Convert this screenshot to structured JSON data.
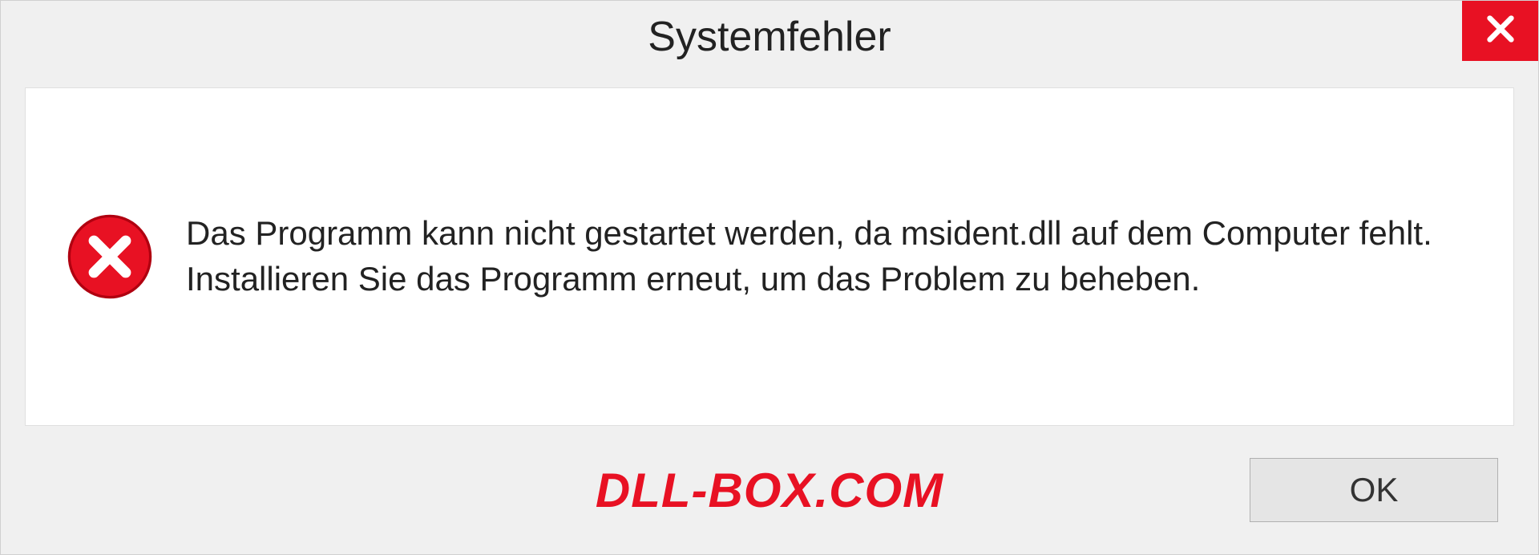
{
  "titlebar": {
    "title": "Systemfehler"
  },
  "message": {
    "text": "Das Programm kann nicht gestartet werden, da msident.dll auf dem Computer fehlt. Installieren Sie das Programm erneut, um das Problem zu beheben."
  },
  "footer": {
    "watermark": "DLL-BOX.COM",
    "ok_label": "OK"
  },
  "colors": {
    "error_red": "#e81123",
    "bg_gray": "#f0f0f0",
    "content_white": "#ffffff"
  }
}
